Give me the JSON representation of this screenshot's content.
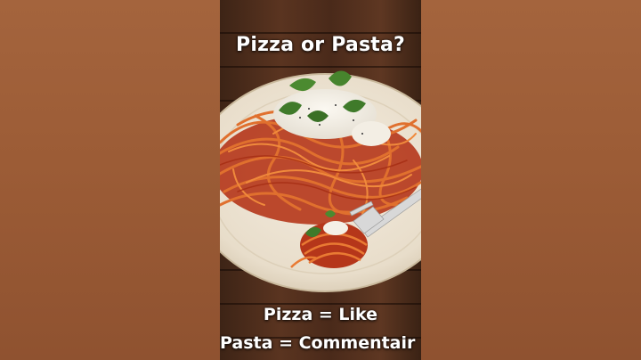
{
  "overlay": {
    "question": "Pizza or Pasta?",
    "vote_like": "Pizza = Like",
    "vote_comment": "Pasta = Commentair"
  },
  "photo": {
    "subject": "spaghetti with tomato sauce, basil and burrata on a plate with a fork"
  },
  "colors": {
    "side_panel": "#9c5c36",
    "table_wood": "#4a2a1a",
    "plate": "#efe6d6",
    "sauce": "#c8401c",
    "basil": "#3f7a2a",
    "text": "#ffffff"
  }
}
